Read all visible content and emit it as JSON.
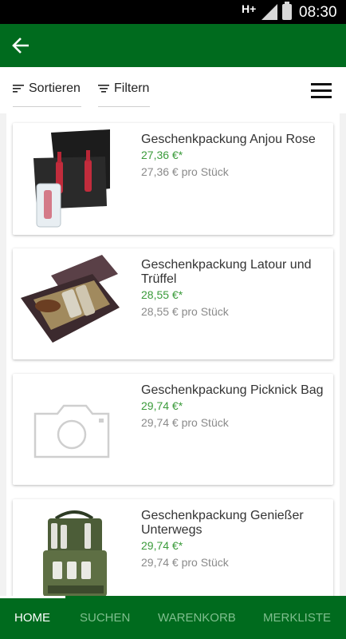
{
  "status_bar": {
    "network": "H+",
    "time": "08:30"
  },
  "app_bar": {
    "back_icon": "arrow-left-icon"
  },
  "toolbar": {
    "sort_label": "Sortieren",
    "filter_label": "Filtern"
  },
  "products": [
    {
      "title": "Geschenkpackung Anjou Rose",
      "price": "27,36 €*",
      "unit_price": "27,36 € pro Stück",
      "image": "gift-box-rose-wine"
    },
    {
      "title": "Geschenkpackung Latour und Trüffel",
      "price": "28,55 €*",
      "unit_price": "28,55 € pro Stück",
      "image": "gift-box-wine-truffle"
    },
    {
      "title": "Geschenkpackung Picknick Bag",
      "price": "29,74 €*",
      "unit_price": "29,74 € pro Stück",
      "image": "camera-placeholder-icon"
    },
    {
      "title": "Geschenkpackung Genießer Unterwegs",
      "price": "29,74 €*",
      "unit_price": "29,74 € pro Stück",
      "image": "picnic-cooler-bag"
    }
  ],
  "bottom_nav": {
    "items": [
      "HOME",
      "SUCHEN",
      "WARENKORB",
      "MERKLISTE"
    ],
    "active": "HOME"
  },
  "colors": {
    "primary": "#006b1e",
    "price": "#3a9b3a",
    "muted": "#8a8a8a"
  }
}
